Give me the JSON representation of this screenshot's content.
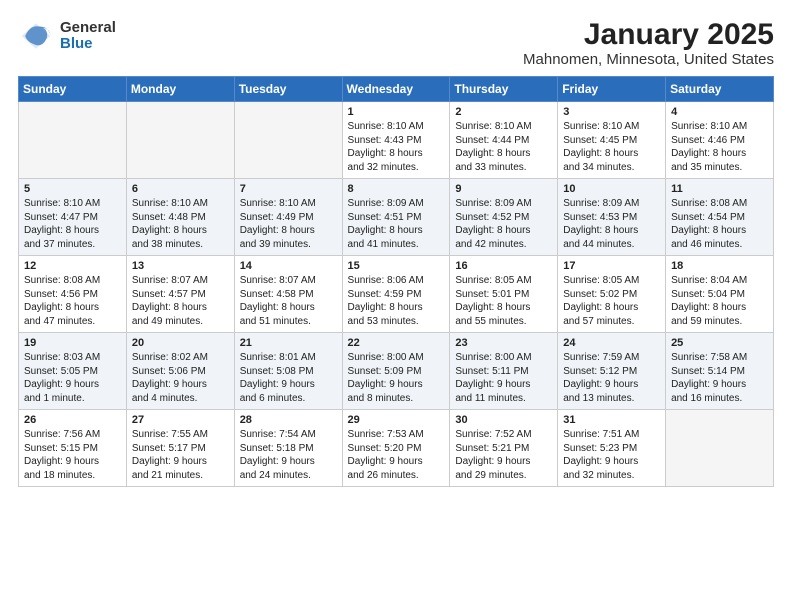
{
  "header": {
    "logo": {
      "line1": "General",
      "line2": "Blue"
    },
    "title": "January 2025",
    "subtitle": "Mahnomen, Minnesota, United States"
  },
  "weekdays": [
    "Sunday",
    "Monday",
    "Tuesday",
    "Wednesday",
    "Thursday",
    "Friday",
    "Saturday"
  ],
  "weeks": [
    [
      {
        "day": "",
        "info": ""
      },
      {
        "day": "",
        "info": ""
      },
      {
        "day": "",
        "info": ""
      },
      {
        "day": "1",
        "info": "Sunrise: 8:10 AM\nSunset: 4:43 PM\nDaylight: 8 hours\nand 32 minutes."
      },
      {
        "day": "2",
        "info": "Sunrise: 8:10 AM\nSunset: 4:44 PM\nDaylight: 8 hours\nand 33 minutes."
      },
      {
        "day": "3",
        "info": "Sunrise: 8:10 AM\nSunset: 4:45 PM\nDaylight: 8 hours\nand 34 minutes."
      },
      {
        "day": "4",
        "info": "Sunrise: 8:10 AM\nSunset: 4:46 PM\nDaylight: 8 hours\nand 35 minutes."
      }
    ],
    [
      {
        "day": "5",
        "info": "Sunrise: 8:10 AM\nSunset: 4:47 PM\nDaylight: 8 hours\nand 37 minutes."
      },
      {
        "day": "6",
        "info": "Sunrise: 8:10 AM\nSunset: 4:48 PM\nDaylight: 8 hours\nand 38 minutes."
      },
      {
        "day": "7",
        "info": "Sunrise: 8:10 AM\nSunset: 4:49 PM\nDaylight: 8 hours\nand 39 minutes."
      },
      {
        "day": "8",
        "info": "Sunrise: 8:09 AM\nSunset: 4:51 PM\nDaylight: 8 hours\nand 41 minutes."
      },
      {
        "day": "9",
        "info": "Sunrise: 8:09 AM\nSunset: 4:52 PM\nDaylight: 8 hours\nand 42 minutes."
      },
      {
        "day": "10",
        "info": "Sunrise: 8:09 AM\nSunset: 4:53 PM\nDaylight: 8 hours\nand 44 minutes."
      },
      {
        "day": "11",
        "info": "Sunrise: 8:08 AM\nSunset: 4:54 PM\nDaylight: 8 hours\nand 46 minutes."
      }
    ],
    [
      {
        "day": "12",
        "info": "Sunrise: 8:08 AM\nSunset: 4:56 PM\nDaylight: 8 hours\nand 47 minutes."
      },
      {
        "day": "13",
        "info": "Sunrise: 8:07 AM\nSunset: 4:57 PM\nDaylight: 8 hours\nand 49 minutes."
      },
      {
        "day": "14",
        "info": "Sunrise: 8:07 AM\nSunset: 4:58 PM\nDaylight: 8 hours\nand 51 minutes."
      },
      {
        "day": "15",
        "info": "Sunrise: 8:06 AM\nSunset: 4:59 PM\nDaylight: 8 hours\nand 53 minutes."
      },
      {
        "day": "16",
        "info": "Sunrise: 8:05 AM\nSunset: 5:01 PM\nDaylight: 8 hours\nand 55 minutes."
      },
      {
        "day": "17",
        "info": "Sunrise: 8:05 AM\nSunset: 5:02 PM\nDaylight: 8 hours\nand 57 minutes."
      },
      {
        "day": "18",
        "info": "Sunrise: 8:04 AM\nSunset: 5:04 PM\nDaylight: 8 hours\nand 59 minutes."
      }
    ],
    [
      {
        "day": "19",
        "info": "Sunrise: 8:03 AM\nSunset: 5:05 PM\nDaylight: 9 hours\nand 1 minute."
      },
      {
        "day": "20",
        "info": "Sunrise: 8:02 AM\nSunset: 5:06 PM\nDaylight: 9 hours\nand 4 minutes."
      },
      {
        "day": "21",
        "info": "Sunrise: 8:01 AM\nSunset: 5:08 PM\nDaylight: 9 hours\nand 6 minutes."
      },
      {
        "day": "22",
        "info": "Sunrise: 8:00 AM\nSunset: 5:09 PM\nDaylight: 9 hours\nand 8 minutes."
      },
      {
        "day": "23",
        "info": "Sunrise: 8:00 AM\nSunset: 5:11 PM\nDaylight: 9 hours\nand 11 minutes."
      },
      {
        "day": "24",
        "info": "Sunrise: 7:59 AM\nSunset: 5:12 PM\nDaylight: 9 hours\nand 13 minutes."
      },
      {
        "day": "25",
        "info": "Sunrise: 7:58 AM\nSunset: 5:14 PM\nDaylight: 9 hours\nand 16 minutes."
      }
    ],
    [
      {
        "day": "26",
        "info": "Sunrise: 7:56 AM\nSunset: 5:15 PM\nDaylight: 9 hours\nand 18 minutes."
      },
      {
        "day": "27",
        "info": "Sunrise: 7:55 AM\nSunset: 5:17 PM\nDaylight: 9 hours\nand 21 minutes."
      },
      {
        "day": "28",
        "info": "Sunrise: 7:54 AM\nSunset: 5:18 PM\nDaylight: 9 hours\nand 24 minutes."
      },
      {
        "day": "29",
        "info": "Sunrise: 7:53 AM\nSunset: 5:20 PM\nDaylight: 9 hours\nand 26 minutes."
      },
      {
        "day": "30",
        "info": "Sunrise: 7:52 AM\nSunset: 5:21 PM\nDaylight: 9 hours\nand 29 minutes."
      },
      {
        "day": "31",
        "info": "Sunrise: 7:51 AM\nSunset: 5:23 PM\nDaylight: 9 hours\nand 32 minutes."
      },
      {
        "day": "",
        "info": ""
      }
    ]
  ]
}
